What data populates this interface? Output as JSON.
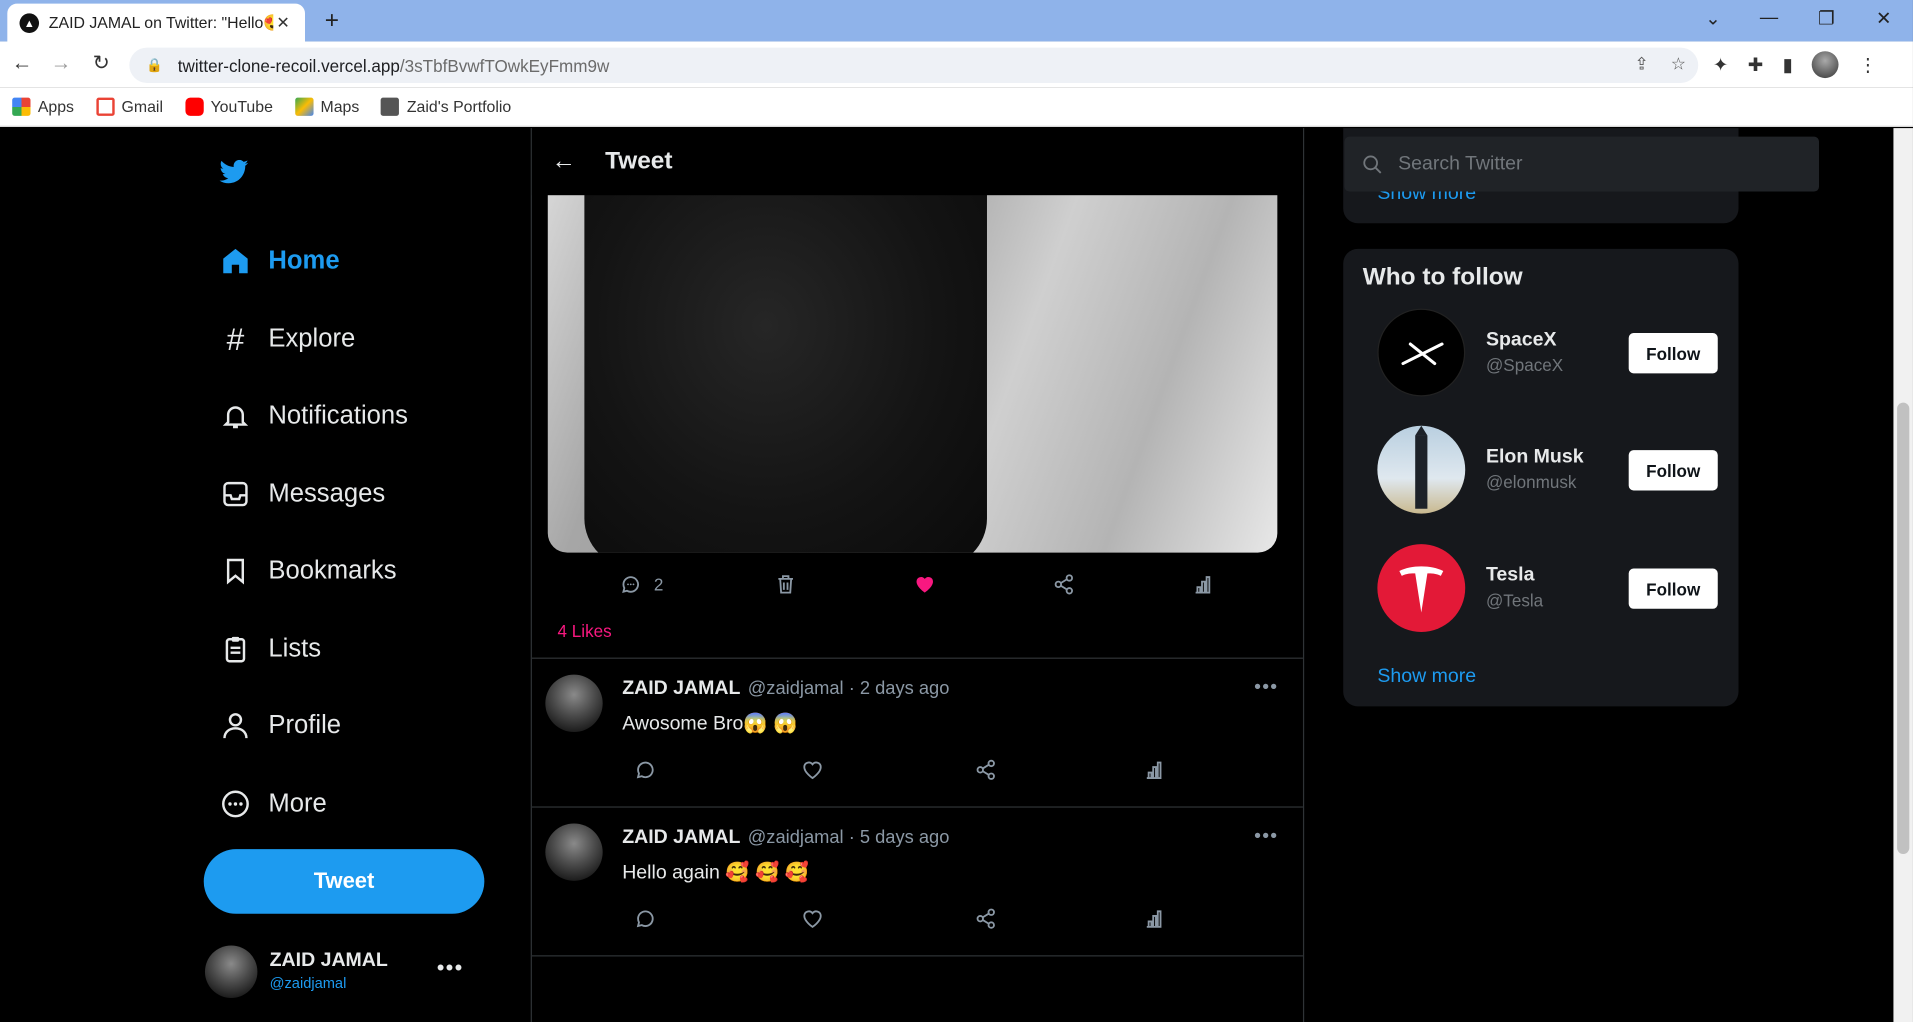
{
  "browser": {
    "tab_title": "ZAID JAMAL on Twitter: \"Hello😍",
    "url_host": "twitter-clone-recoil.vercel.app",
    "url_path": "/3sTbfBvwfTOwkEyFmm9w",
    "bookmarks": [
      "Apps",
      "Gmail",
      "YouTube",
      "Maps",
      "Zaid's Portfolio"
    ]
  },
  "sidebar": {
    "items": [
      {
        "label": "Home",
        "icon": "home-icon",
        "active": true
      },
      {
        "label": "Explore",
        "icon": "hashtag-icon"
      },
      {
        "label": "Notifications",
        "icon": "bell-icon"
      },
      {
        "label": "Messages",
        "icon": "inbox-icon"
      },
      {
        "label": "Bookmarks",
        "icon": "bookmark-icon"
      },
      {
        "label": "Lists",
        "icon": "clipboard-icon"
      },
      {
        "label": "Profile",
        "icon": "user-icon"
      },
      {
        "label": "More",
        "icon": "more-circle-icon"
      }
    ],
    "tweet_button": "Tweet",
    "me": {
      "name": "ZAID JAMAL",
      "handle": "@zaidjamal"
    }
  },
  "header": {
    "title": "Tweet"
  },
  "tweet": {
    "reply_count": "2",
    "likes_text": "4 Likes"
  },
  "replies": [
    {
      "name": "ZAID JAMAL",
      "meta": "@zaidjamal · 2 days ago",
      "text": "Awosome Bro😱 😱"
    },
    {
      "name": "ZAID JAMAL",
      "meta": "@zaidjamal · 5 days ago",
      "text": "Hello again 🥰 🥰 🥰"
    }
  ],
  "search": {
    "placeholder": "Search Twitter"
  },
  "trends": {
    "show_more": "Show more"
  },
  "who_to_follow": {
    "title": "Who to follow",
    "accounts": [
      {
        "name": "SpaceX",
        "handle": "@SpaceX",
        "button": "Follow"
      },
      {
        "name": "Elon Musk",
        "handle": "@elonmusk",
        "button": "Follow"
      },
      {
        "name": "Tesla",
        "handle": "@Tesla",
        "button": "Follow"
      }
    ],
    "show_more": "Show more"
  },
  "colors": {
    "accent": "#1d9bf0",
    "like": "#f91880",
    "background": "#000000",
    "card": "#16181c"
  }
}
